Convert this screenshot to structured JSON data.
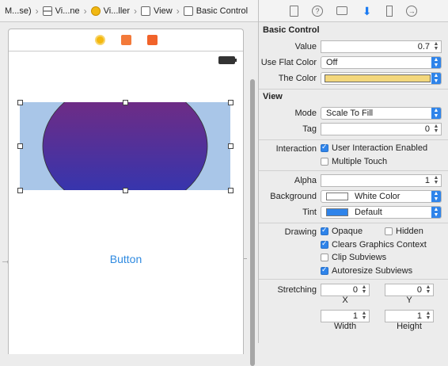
{
  "breadcrumb": [
    {
      "label": "M...se)",
      "icon": "folder-icon"
    },
    {
      "label": "Vi...ne",
      "icon": "storyboard-icon"
    },
    {
      "label": "Vi...ller",
      "icon": "view-controller-icon"
    },
    {
      "label": "View",
      "icon": "view-icon"
    },
    {
      "label": "Basic Control",
      "icon": "view-icon"
    }
  ],
  "canvas": {
    "button_label": "Button",
    "gradient_top": "#7b2a7c",
    "gradient_bottom": "#2a37b6",
    "image_bg": "#a9c6e8"
  },
  "inspector": {
    "basic_control": {
      "title": "Basic Control",
      "value_label": "Value",
      "value": "0.7",
      "flat_color_label": "Use Flat Color",
      "flat_color": "Off",
      "the_color_label": "The Color",
      "the_color_hex": "#f3d77c"
    },
    "view": {
      "title": "View",
      "mode_label": "Mode",
      "mode": "Scale To Fill",
      "tag_label": "Tag",
      "tag": "0",
      "interaction_label": "Interaction",
      "user_interaction": "User Interaction Enabled",
      "multiple_touch": "Multiple Touch",
      "alpha_label": "Alpha",
      "alpha": "1",
      "background_label": "Background",
      "background": "White Color",
      "tint_label": "Tint",
      "tint": "Default",
      "tint_hex": "#2f84ea",
      "drawing_label": "Drawing",
      "opaque": "Opaque",
      "hidden": "Hidden",
      "clears_graphics": "Clears Graphics Context",
      "clip_subviews": "Clip Subviews",
      "autoresize": "Autoresize Subviews",
      "stretching_label": "Stretching",
      "stretch_x": "0",
      "stretch_y": "0",
      "x_label": "X",
      "y_label": "Y",
      "width": "1",
      "height": "1",
      "width_label": "Width",
      "height_label": "Height"
    }
  }
}
